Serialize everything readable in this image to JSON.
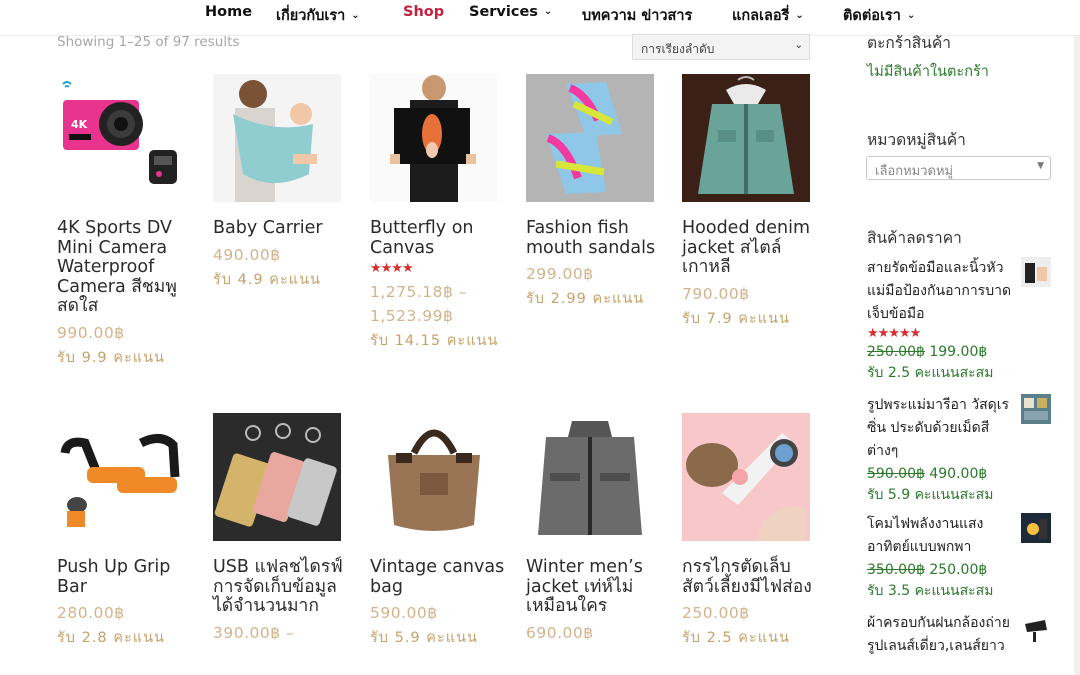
{
  "nav": {
    "items": [
      {
        "label": "Home",
        "caret": false,
        "active": false
      },
      {
        "label": "เกี่ยวกับเรา",
        "caret": true,
        "active": false
      },
      {
        "label": "Shop",
        "caret": false,
        "active": true
      },
      {
        "label": "Services",
        "caret": true,
        "active": false
      },
      {
        "label": "บทความ ข่าวสาร",
        "caret": false,
        "active": false
      },
      {
        "label": "แกลเลอรี่",
        "caret": true,
        "active": false
      },
      {
        "label": "ติดต่อเรา",
        "caret": true,
        "active": false
      }
    ]
  },
  "shop": {
    "results_text": "Showing 1–25 of 97 results",
    "sort_value": "การเรียงลำดับ"
  },
  "products": [
    {
      "name": "4K Sports DV Mini Camera Waterproof Camera สีชมพูสดใส",
      "price": "990.00฿",
      "points": "รับ 9.9 คะแนน",
      "rating": null,
      "icon": "camera-icon"
    },
    {
      "name": "Baby Carrier",
      "price": "490.00฿",
      "points": "รับ 4.9 คะแนน",
      "rating": null,
      "icon": "baby-carrier-icon"
    },
    {
      "name": "Butterfly on Canvas",
      "price": "1,275.18฿ – 1,523.99฿",
      "points": "รับ 14.15 คะแนน",
      "rating": "★★★★",
      "icon": "canvas-print-icon"
    },
    {
      "name": "Fashion fish mouth sandals",
      "price": "299.00฿",
      "points": "รับ 2.99 คะแนน",
      "rating": null,
      "icon": "sandals-icon"
    },
    {
      "name": "Hooded denim jacket สไตล์เกาหลี",
      "price": "790.00฿",
      "points": "รับ 7.9 คะแนน",
      "rating": null,
      "icon": "denim-jacket-icon"
    },
    {
      "name": "Push Up Grip Bar",
      "price": "280.00฿",
      "points": "รับ 2.8 คะแนน",
      "rating": null,
      "icon": "pushup-bar-icon"
    },
    {
      "name": "USB แฟลชไดรฟ์ การจัดเก็บข้อมูลได้จำนวนมาก",
      "price": "390.00฿ –",
      "points": "",
      "rating": null,
      "icon": "usb-drive-icon"
    },
    {
      "name": "Vintage canvas bag",
      "price": "590.00฿",
      "points": "รับ 5.9 คะแนน",
      "rating": null,
      "icon": "bag-icon"
    },
    {
      "name": "Winter men’s jacket เท่ห์ไม่เหมือนใคร",
      "price": "690.00฿",
      "points": "",
      "rating": null,
      "icon": "winter-jacket-icon"
    },
    {
      "name": "กรรไกรตัดเล็บสัตว์เลี้ยงมีไฟส่อง",
      "price": "250.00฿",
      "points": "รับ 2.5 คะแนน",
      "rating": null,
      "icon": "nail-clipper-icon"
    }
  ],
  "sidebar": {
    "cart_title": "ตะกร้าสินค้า",
    "cart_empty": "ไม่มีสินค้าในตะกร้า",
    "category_title": "หมวดหมู่สินค้า",
    "category_placeholder": "เลือกหมวดหมู่",
    "sale_title": "สินค้าลดราคา",
    "sale_items": [
      {
        "name": "สายรัดข้อมือและนิ้วหัวแม่มือป้องกันอาการบาดเจ็บข้อมือ",
        "rating": "★★★★★",
        "old_price": "250.00฿",
        "new_price": "199.00฿",
        "points": "รับ 2.5 คะแนนสะสม",
        "icon": "wrist-strap-icon"
      },
      {
        "name": "รูปพระแม่มารีอา วัสดุเรซิ่น ประดับด้วยเม็ดสีต่างๆ",
        "rating": "",
        "old_price": "590.00฿",
        "new_price": "490.00฿",
        "points": "รับ 5.9 คะแนนสะสม",
        "icon": "statue-icon"
      },
      {
        "name": "โคมไฟพลังงานแสงอาทิตย์แบบพกพา",
        "rating": "",
        "old_price": "350.00฿",
        "new_price": "250.00฿",
        "points": "รับ 3.5 คะแนนสะสม",
        "icon": "solar-lamp-icon"
      },
      {
        "name": "ผ้าครอบกันฝนกล้องถ่ายรูปเลนส์เดี่ยว,เลนส์ยาว",
        "rating": "",
        "old_price": "",
        "new_price": "",
        "points": "",
        "icon": "rain-cover-icon"
      }
    ]
  },
  "colors": {
    "accent": "#c4203f",
    "price": "#d2b48c",
    "sidebar_link": "#2b7a2b",
    "star": "#d62d2d"
  }
}
